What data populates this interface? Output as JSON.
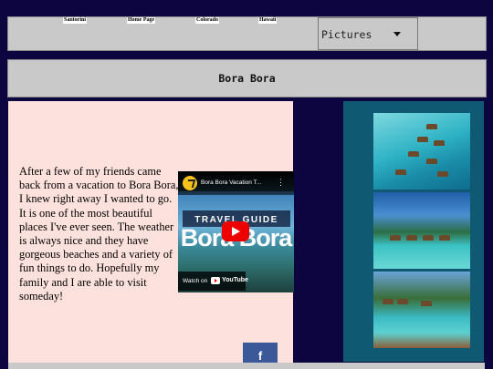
{
  "nav": {
    "links": [
      "Santorini",
      "Home Page",
      "Colorado",
      "Hawaii"
    ],
    "dropdown_value": "Pictures"
  },
  "page_title": "Bora Bora",
  "body_text": "After a few of my friends came back from a vacation to Bora Bora, I knew right away I wanted to go. It is one of the most beautiful places I've ever seen. The weather is always nice and they have gorgeous beaches and a variety of fun things to do. Hopefully my family and I are able to visit someday!",
  "video": {
    "title": "Bora Bora Vacation T...",
    "menu": "⋮",
    "banner": "TRAVEL GUIDE",
    "big_title": "Bora Bora",
    "watch_on": "Watch on",
    "brand": "YouTube"
  },
  "social": {
    "facebook_label": "f"
  },
  "gallery": {
    "icons": [
      "overwater-bungalows-photo",
      "mountain-lagoon-photo",
      "resort-deck-photo"
    ]
  },
  "colors": {
    "page_bg": "#0d0540",
    "bar_gray": "#c9c9c9",
    "content_bg": "#fde1dc",
    "gallery_bg": "#0f5a72",
    "facebook": "#3b5998",
    "youtube_red": "#ee0000"
  }
}
